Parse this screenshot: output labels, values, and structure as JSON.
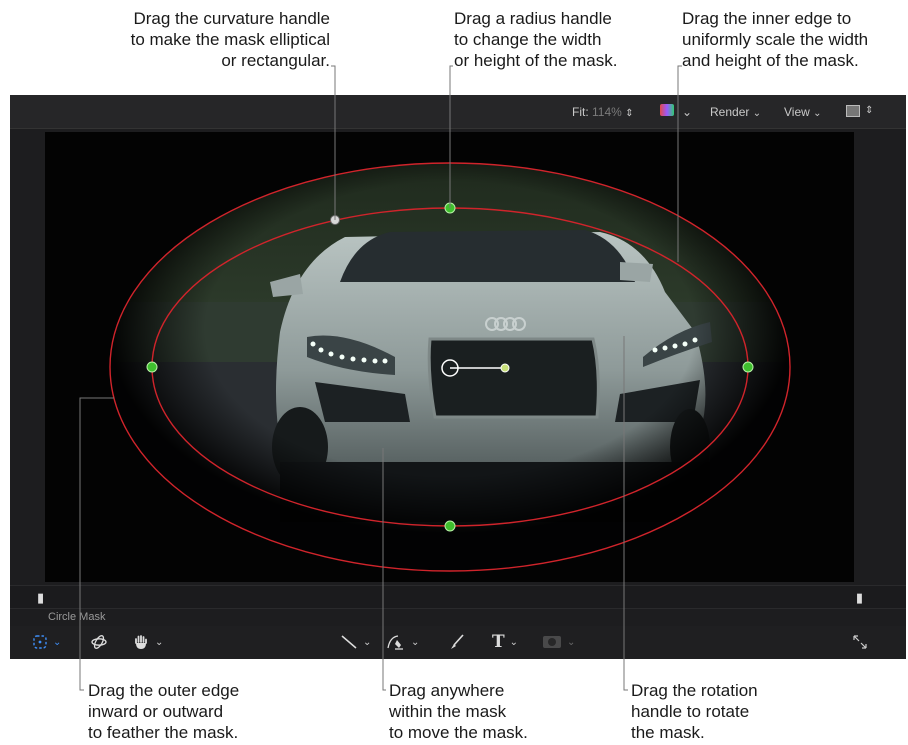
{
  "callouts": {
    "curvature": "Drag the curvature handle\nto make the mask elliptical\nor rectangular.",
    "radius": "Drag a radius handle\nto change the width\nor height of the mask.",
    "inner_edge": "Drag the inner edge to\nuniformly scale the width\nand height of the mask.",
    "outer_edge": "Drag the outer edge\ninward or outward\nto feather the mask.",
    "anywhere": "Drag anywhere\nwithin the mask\nto move the mask.",
    "rotation": "Drag the rotation\nhandle to rotate\nthe mask."
  },
  "top_toolbar": {
    "fit_label": "Fit:",
    "fit_value": "114%",
    "render_label": "Render",
    "view_label": "View"
  },
  "timeline": {
    "track_label": "Circle Mask"
  },
  "colors": {
    "mask_outline": "#d0242b",
    "radius_handle": "#3fbf2e",
    "active_tool": "#3e8ef7"
  },
  "icons": {
    "stepper": "⇕",
    "chevron": "⌄",
    "select_tool": "select-transform-icon",
    "orbit_tool": "3d-transform-icon",
    "hand_tool": "pan-hand-icon",
    "line_tool": "line-icon",
    "bezier_tool": "bezier-pen-icon",
    "brush_tool": "paint-brush-icon",
    "text_tool": "text-icon",
    "mask_tool": "mask-icon",
    "expand": "expand-icon"
  }
}
